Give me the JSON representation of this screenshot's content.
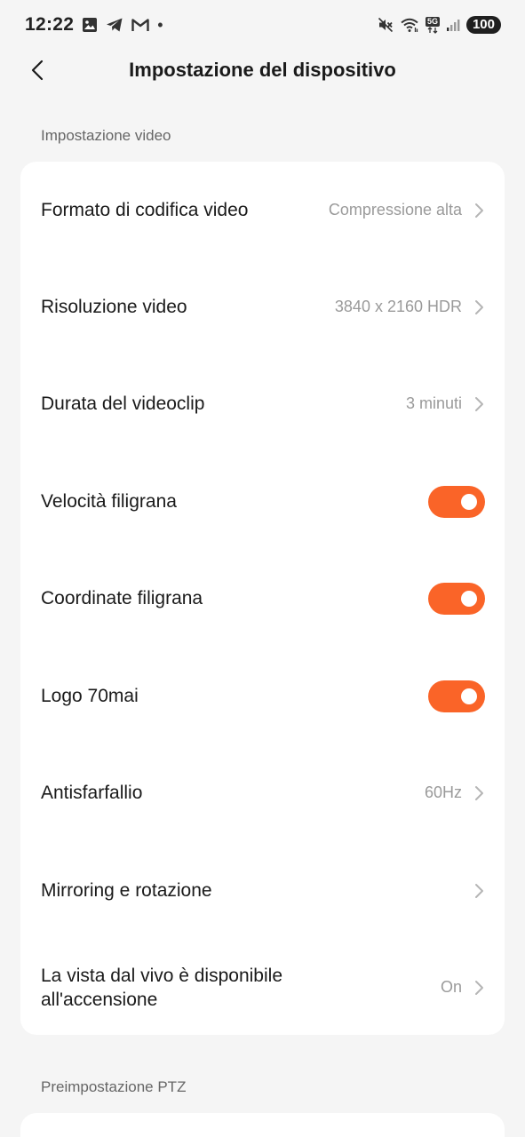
{
  "status_bar": {
    "time": "12:22",
    "dot": "•",
    "net": "5G",
    "battery": "100",
    "icons": [
      "image-icon",
      "telegram-icon",
      "gmail-icon",
      "mute-icon",
      "wifi-icon",
      "5g-icon",
      "signal-icon",
      "battery-icon"
    ]
  },
  "header": {
    "title": "Impostazione del dispositivo",
    "back_icon": "chevron-left-icon"
  },
  "video_section": {
    "label": "Impostazione video",
    "rows": [
      {
        "label": "Formato di codifica video",
        "value": "Compressione alta"
      },
      {
        "label": "Risoluzione video",
        "value": "3840 x 2160 HDR"
      },
      {
        "label": "Durata del videoclip",
        "value": "3 minuti"
      },
      {
        "label": "Velocità filigrana",
        "toggle": true
      },
      {
        "label": "Coordinate filigrana",
        "toggle": true
      },
      {
        "label": "Logo 70mai",
        "toggle": true
      },
      {
        "label": "Antisfarfallio",
        "value": "60Hz"
      },
      {
        "label": "Mirroring e rotazione",
        "value": ""
      },
      {
        "label": "La vista dal vivo è disponibile all'accensione",
        "value": "On"
      }
    ]
  },
  "ptz_section": {
    "label": "Preimpostazione PTZ"
  },
  "colors": {
    "accent": "#fa6428",
    "background": "#f5f5f5",
    "card": "#ffffff",
    "secondary_text": "#9a9a9a"
  }
}
